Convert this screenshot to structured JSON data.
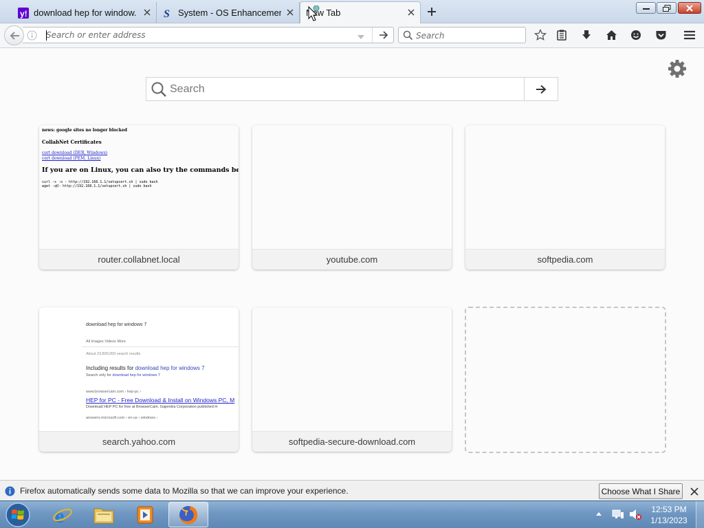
{
  "window": {
    "tabs": [
      {
        "title": "download hep for window...",
        "favicon": "yahoo-favicon",
        "active": false
      },
      {
        "title": "System - OS Enhancement...",
        "favicon": "softpedia-favicon",
        "active": false
      },
      {
        "title": "New Tab",
        "favicon": "none",
        "active": true
      }
    ]
  },
  "navbar": {
    "url_placeholder": "Search or enter address",
    "url_value": "",
    "search_placeholder": "Search"
  },
  "newtab": {
    "search_placeholder": "Search",
    "tiles": [
      {
        "label": "router.collabnet.local",
        "thumbnail": "router"
      },
      {
        "label": "youtube.com",
        "thumbnail": "blank"
      },
      {
        "label": "softpedia.com",
        "thumbnail": "blank"
      },
      {
        "label": "search.yahoo.com",
        "thumbnail": "yahoo"
      },
      {
        "label": "softpedia-secure-download.com",
        "thumbnail": "blank"
      },
      {
        "label": "",
        "thumbnail": "empty-placeholder"
      }
    ],
    "router_thumb": {
      "news": "news: google sites no longer blocked",
      "heading": "CollabNet Certificates",
      "link1": "cert download (DER, Windows)",
      "link2": "cert download (PEM, Linux)",
      "heading2": "If you are on Linux, you can also try the commands below:",
      "cmd1": "curl -s -o - http://192.168.1.1/setupcert.sh | sudo bash",
      "cmd2": "wget -qO- http://192.168.1.1/setupcert.sh | sudo bash"
    },
    "yahoo_thumb": {
      "query": "download hep for windows 7",
      "tabs": "All     Images     Videos     More",
      "count": "About 23,800,000 search results",
      "including_prefix": "Including results for ",
      "including_query": "download hep for windows 7",
      "only_prefix": "Search only for ",
      "only_query": "download hep for windows 7",
      "site": "www.browsercam.com › hep-pc ›",
      "result_title": "HEP for PC - Free Download & Install on Windows PC, M",
      "result_desc": "Download HEP PC for free at BrowserCam. Gajendra Corporation published H",
      "site2": "answers.microsoft.com › en-us › windows ›"
    }
  },
  "notification": {
    "text": "Firefox automatically sends some data to Mozilla so that we can improve your experience.",
    "button": "Choose What I Share"
  },
  "taskbar": {
    "time": "12:53 PM",
    "date": "1/13/2023",
    "apps": [
      "internet-explorer",
      "file-explorer",
      "media-player",
      "firefox"
    ]
  },
  "colors": {
    "accent_blue": "#0a84ff",
    "taskbar": "#6f97c2",
    "close_red": "#c7432a"
  }
}
